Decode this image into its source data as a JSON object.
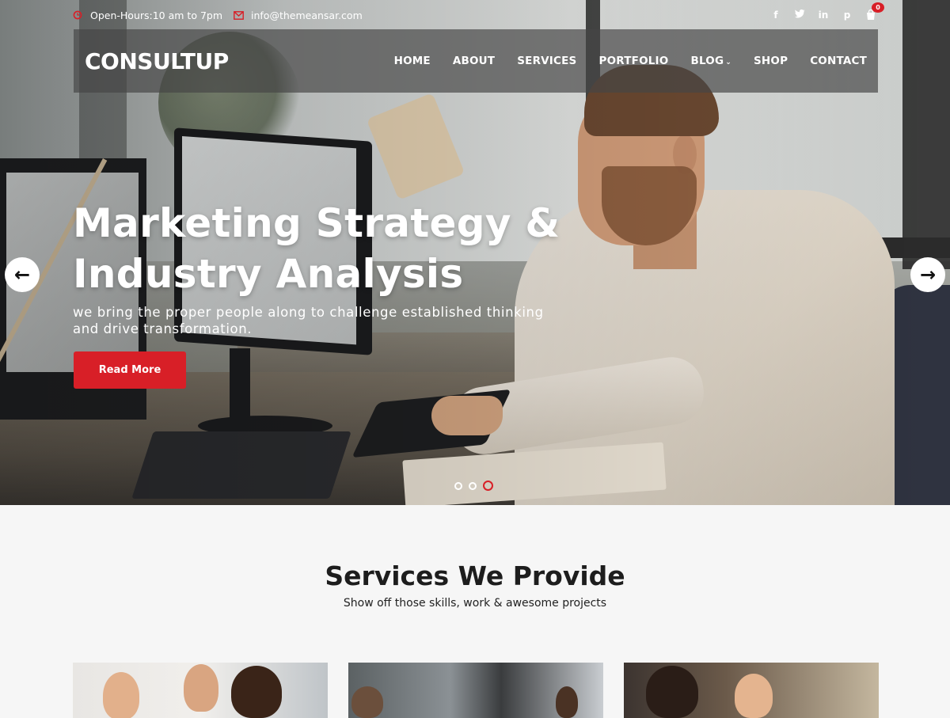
{
  "topbar": {
    "hours": "Open-Hours:10 am to 7pm",
    "email": "info@themeansar.com",
    "social": [
      "f",
      "t",
      "in",
      "p"
    ],
    "cart_count": "0"
  },
  "nav": {
    "logo": "CONSULTUP",
    "items": [
      "HOME",
      "ABOUT",
      "SERVICES",
      "PORTFOLIO",
      "BLOG",
      "SHOP",
      "CONTACT"
    ]
  },
  "hero": {
    "title_line1": "Marketing Strategy &",
    "title_line2": "Industry Analysis",
    "subtitle_line1": "we bring the proper people along to challenge established thinking",
    "subtitle_line2": "and drive transformation.",
    "button": "Read More",
    "prev_arrow": "←",
    "next_arrow": "→",
    "slides": 3,
    "active_slide": 3
  },
  "services": {
    "title": "Services We Provide",
    "subtitle": "Show off those skills, work & awesome projects"
  },
  "colors": {
    "accent": "#d81f27",
    "nav_bg": "rgba(70,70,70,.68)",
    "page_bg": "#f6f6f6"
  }
}
